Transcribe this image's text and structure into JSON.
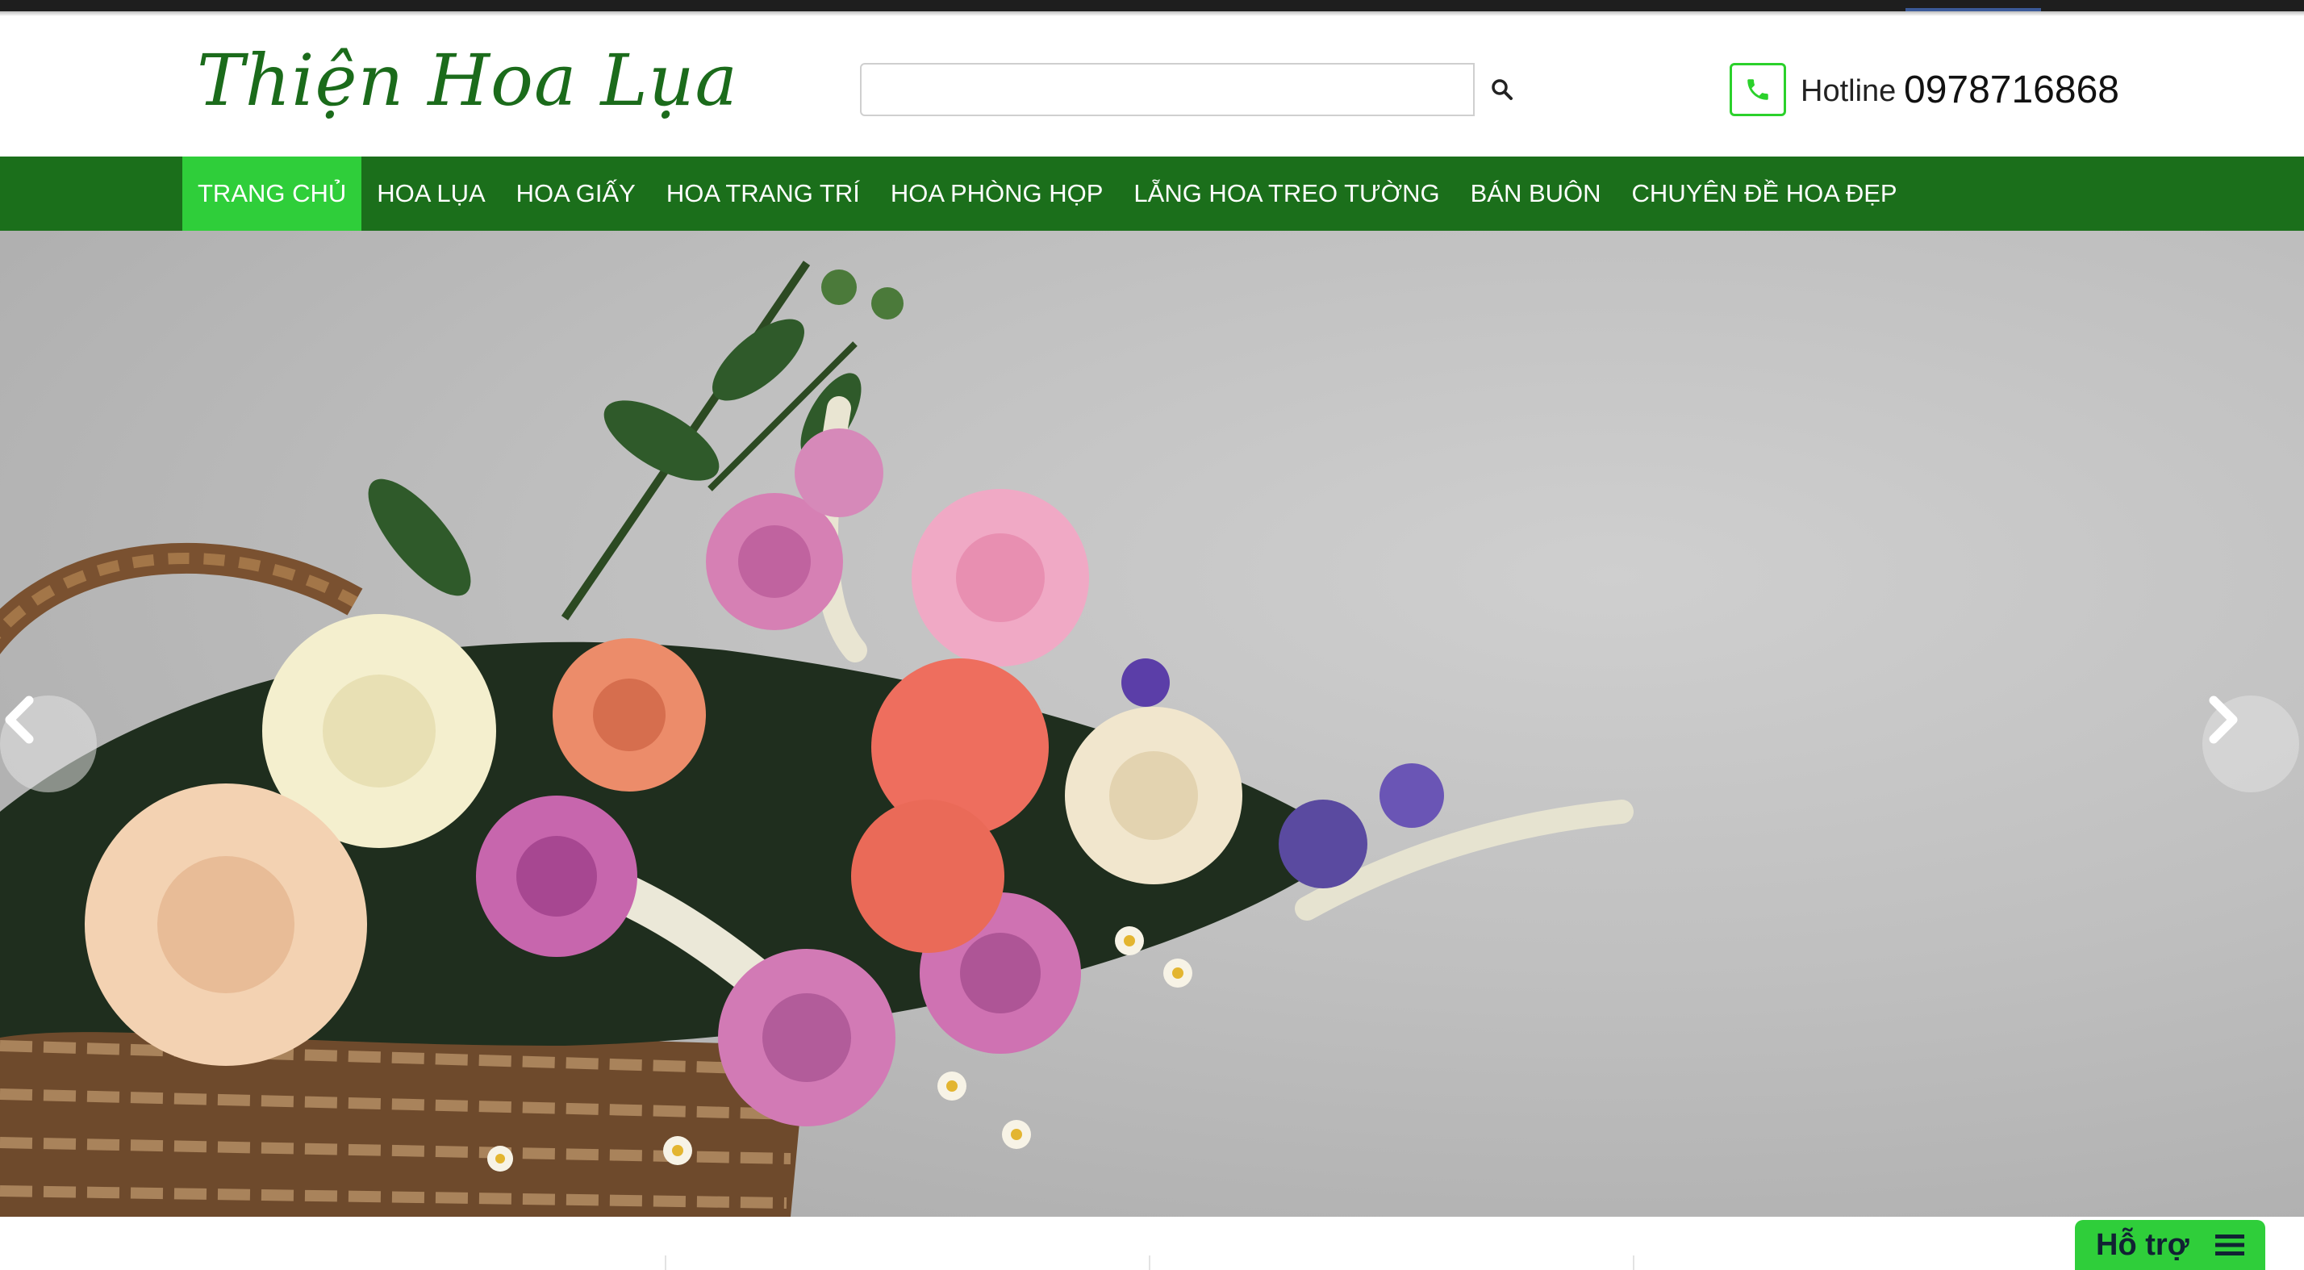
{
  "header": {
    "logo_text": "Thiện Hoa Lụa",
    "search": {
      "value": "",
      "placeholder": ""
    },
    "hotline_label": "Hotline",
    "hotline_number": "0978716868"
  },
  "nav": {
    "items": [
      {
        "label": "TRANG CHỦ",
        "active": true
      },
      {
        "label": "HOA LỤA"
      },
      {
        "label": "HOA GIẤY"
      },
      {
        "label": "HOA TRANG TRÍ"
      },
      {
        "label": "HOA PHÒNG HỌP"
      },
      {
        "label": "LẴNG HOA TREO TƯỜNG"
      },
      {
        "label": "BÁN BUÔN"
      },
      {
        "label": "CHUYÊN ĐỀ HOA ĐẸP"
      }
    ]
  },
  "slider": {
    "prev_icon": "chevron-left-icon",
    "next_icon": "chevron-right-icon"
  },
  "support": {
    "label": "Hỗ trợ",
    "icon": "menu-icon"
  },
  "colors": {
    "nav_bg": "#1b6f1b",
    "nav_active": "#2fce3a",
    "logo": "#1b6b1b",
    "phone_accent": "#2bd12b"
  }
}
